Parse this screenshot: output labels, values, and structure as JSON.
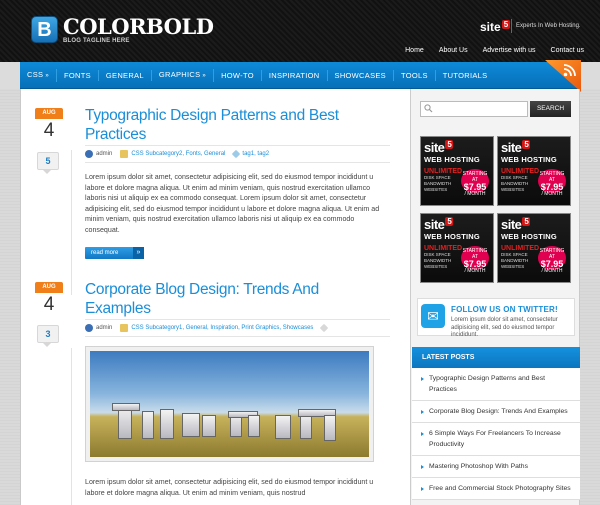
{
  "header": {
    "logo_letter": "B",
    "logo_text": "COLORBOLD",
    "tagline": "BLOG TAGLINE HERE",
    "sponsor_name": "site",
    "sponsor_digit": "5",
    "sponsor_tag": "Experts In Web Hosting.",
    "top_nav": [
      "Home",
      "About Us",
      "Advertise with us",
      "Contact us"
    ]
  },
  "nav": {
    "items": [
      {
        "label": "CSS",
        "arrow": "»"
      },
      {
        "label": "FONTS",
        "arrow": ""
      },
      {
        "label": "GENERAL",
        "arrow": ""
      },
      {
        "label": "GRAPHICS",
        "arrow": "»"
      },
      {
        "label": "HOW-TO",
        "arrow": ""
      },
      {
        "label": "INSPIRATION",
        "arrow": ""
      },
      {
        "label": "SHOWCASES",
        "arrow": ""
      },
      {
        "label": "TOOLS",
        "arrow": ""
      },
      {
        "label": "TUTORIALS",
        "arrow": ""
      }
    ],
    "rss_icon": "rss-icon"
  },
  "posts": [
    {
      "month": "AUG",
      "day": "4",
      "comments": "5",
      "title": "Typographic Design Patterns and Best Practices",
      "author": "admin",
      "categories": "CSS Subcategory2, Fonts, General",
      "tags": "tag1, tag2",
      "excerpt": "Lorem ipsum dolor sit amet, consectetur adipisicing elit, sed do eiusmod tempor incididunt u labore et dolore magna aliqua. Ut enim ad minim veniam, quis nostrud exercitation ullamco laboris nisi ut aliquip ex ea commodo consequat. Lorem ipsum dolor sit amet, consectetur adipisicing elit, sed do eiusmod tempor incididunt u labore et dolore magna aliqua. Ut enim ad minim veniam, quis nostrud exercitation ullamco laboris nisi ut aliquip ex ea commodo consequat.",
      "read_more": "read more"
    },
    {
      "month": "AUG",
      "day": "4",
      "comments": "3",
      "title": "Corporate Blog Design: Trends And Examples",
      "author": "admin",
      "categories": "CSS Subcategory1, General, Inspiration, Print Graphics, Showcases",
      "excerpt": "Lorem ipsum dolor sit amet, consectetur adipisicing elit, sed do eiusmod tempor incididunt u labore et dolore magna aliqua. Ut enim ad minim veniam, quis nostrud"
    }
  ],
  "sidebar": {
    "search_placeholder": "",
    "search_button": "SEARCH",
    "ads": [
      {
        "brand": "site",
        "digit": "5",
        "title": "WEB HOSTING",
        "promo": "UNLIMITED",
        "features": "DISK SPACE BANDWIDTH WEBSITES",
        "burst_top": "STARTING AT",
        "price": "$7.95",
        "burst_bottom": "/ MONTH"
      },
      {
        "brand": "site",
        "digit": "5",
        "title": "WEB HOSTING",
        "promo": "UNLIMITED",
        "features": "DISK SPACE BANDWIDTH WEBSITES",
        "burst_top": "STARTING AT",
        "price": "$7.95",
        "burst_bottom": "/ MONTH"
      },
      {
        "brand": "site",
        "digit": "5",
        "title": "WEB HOSTING",
        "promo": "UNLIMITED",
        "features": "DISK SPACE BANDWIDTH WEBSITES",
        "burst_top": "STARTING AT",
        "price": "$7.95",
        "burst_bottom": "/ MONTH"
      },
      {
        "brand": "site",
        "digit": "5",
        "title": "WEB HOSTING",
        "promo": "UNLIMITED",
        "features": "DISK SPACE BANDWIDTH WEBSITES",
        "burst_top": "STARTING AT",
        "price": "$7.95",
        "burst_bottom": "/ MONTH"
      }
    ],
    "twitter_title": "FOLLOW US ON TWITTER!",
    "twitter_text": "Lorem ipsum dolor sit amet, consectetur adipisicing elit, sed do eiusmod tempor incididunt.",
    "latest_title": "LATEST POSTS",
    "latest": [
      "Typographic Design Patterns and Best Practices",
      "Corporate Blog Design: Trends And Examples",
      "6 Simple Ways For Freelancers To Increase Productivity",
      "Mastering Photoshop With Paths",
      "Free and Commercial Stock Photography Sites"
    ]
  },
  "colors": {
    "accent_blue": "#1a8ed8",
    "nav_blue": "#0770b9",
    "date_orange": "#f07e19",
    "rss_orange": "#ff9a2e"
  }
}
